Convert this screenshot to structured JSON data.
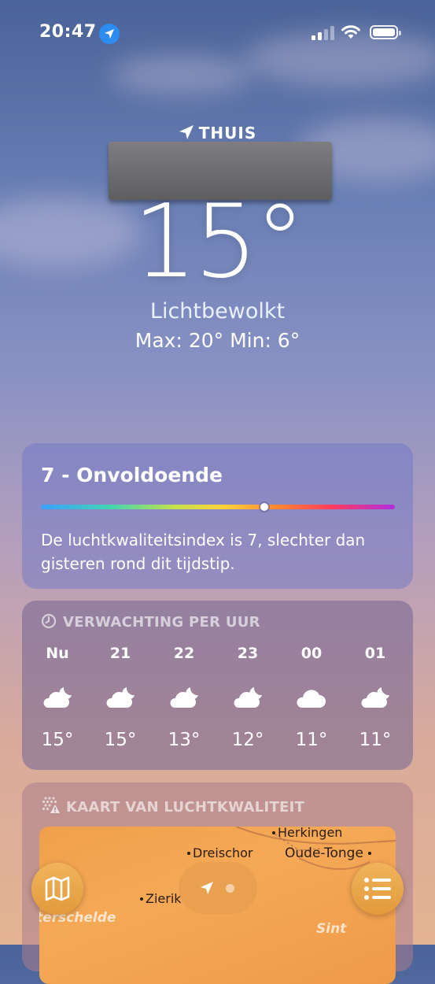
{
  "status_bar": {
    "time": "20:47"
  },
  "location": {
    "label": "THUIS"
  },
  "current": {
    "temperature": "15°",
    "condition": "Lichtbewolkt",
    "minmax": "Max: 20°  Min: 6°"
  },
  "air_quality": {
    "title": "7 - Onvoldoende",
    "index": 7,
    "scale_position": 0.63,
    "description": "De luchtkwaliteitsindex is 7, slechter dan gisteren rond dit tijdstip."
  },
  "hourly": {
    "heading": "VERWACHTING PER UUR",
    "items": [
      {
        "hour": "Nu",
        "icon": "moon-cloud-icon",
        "temp": "15°"
      },
      {
        "hour": "21",
        "icon": "moon-cloud-icon",
        "temp": "15°"
      },
      {
        "hour": "22",
        "icon": "moon-cloud-icon",
        "temp": "13°"
      },
      {
        "hour": "23",
        "icon": "moon-cloud-icon",
        "temp": "12°"
      },
      {
        "hour": "00",
        "icon": "cloud-icon",
        "temp": "11°"
      },
      {
        "hour": "01",
        "icon": "moon-cloud-icon",
        "temp": "11°"
      }
    ]
  },
  "aq_map": {
    "heading": "KAART VAN LUCHTKWALITEIT",
    "places": [
      "Herkingen",
      "Dreischor",
      "Oude-Tonge",
      "Zierik",
      "Sint"
    ],
    "water": [
      "terschelde"
    ]
  }
}
